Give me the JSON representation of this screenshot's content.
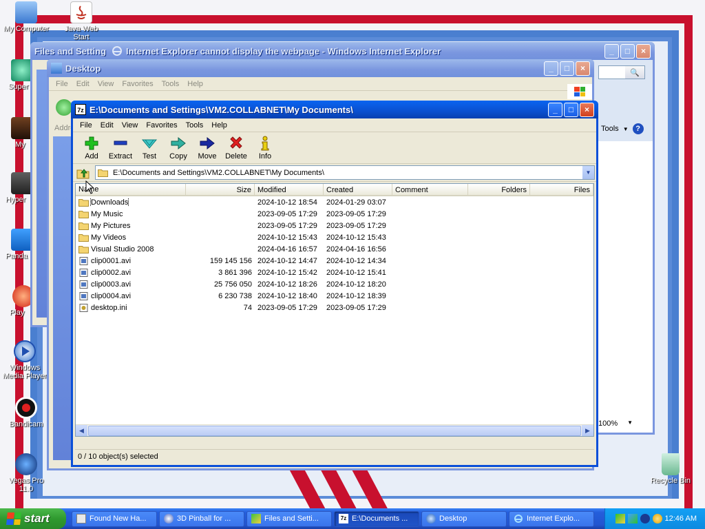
{
  "desktop": {
    "icons": [
      {
        "label": "My Computer"
      },
      {
        "label": "Java Web Start"
      },
      {
        "label": "Super"
      },
      {
        "label": "My"
      },
      {
        "label": "Hyper"
      },
      {
        "label": "Panda"
      },
      {
        "label": "Play"
      },
      {
        "label": "Windows Media Player"
      },
      {
        "label": "Bandicam"
      },
      {
        "label": "Vegas Pro 11.0"
      },
      {
        "label": "Recycle Bin"
      }
    ]
  },
  "windows": {
    "files_settings": {
      "title": "Files and Setting"
    },
    "ie": {
      "title": "Internet Explorer cannot display the webpage - Windows Internet Explorer",
      "tools_label": "Tools",
      "zoom": "100%"
    },
    "desktop_win": {
      "title": "Desktop",
      "menu": [
        "File",
        "Edit",
        "View",
        "Favorites",
        "Tools",
        "Help"
      ],
      "address_label": "Addre"
    }
  },
  "zip": {
    "title": "E:\\Documents and Settings\\VM2.COLLABNET\\My Documents\\",
    "menu": [
      "File",
      "Edit",
      "View",
      "Favorites",
      "Tools",
      "Help"
    ],
    "toolbar": {
      "add": "Add",
      "extract": "Extract",
      "test": "Test",
      "copy": "Copy",
      "move": "Move",
      "delete": "Delete",
      "info": "Info"
    },
    "address": "E:\\Documents and Settings\\VM2.COLLABNET\\My Documents\\",
    "columns": {
      "name": "Name",
      "size": "Size",
      "modified": "Modified",
      "created": "Created",
      "comment": "Comment",
      "folders": "Folders",
      "files": "Files"
    },
    "rows": [
      {
        "name": "Downloads",
        "size": "",
        "modified": "2024-10-12 18:54",
        "created": "2024-01-29 03:07",
        "type": "folder"
      },
      {
        "name": "My Music",
        "size": "",
        "modified": "2023-09-05 17:29",
        "created": "2023-09-05 17:29",
        "type": "folder"
      },
      {
        "name": "My Pictures",
        "size": "",
        "modified": "2023-09-05 17:29",
        "created": "2023-09-05 17:29",
        "type": "folder"
      },
      {
        "name": "My Videos",
        "size": "",
        "modified": "2024-10-12 15:43",
        "created": "2024-10-12 15:43",
        "type": "folder"
      },
      {
        "name": "Visual Studio 2008",
        "size": "",
        "modified": "2024-04-16 16:57",
        "created": "2024-04-16 16:56",
        "type": "folder"
      },
      {
        "name": "clip0001.avi",
        "size": "159 145 156",
        "modified": "2024-10-12 14:47",
        "created": "2024-10-12 14:34",
        "type": "file"
      },
      {
        "name": "clip0002.avi",
        "size": "3 861 396",
        "modified": "2024-10-12 15:42",
        "created": "2024-10-12 15:41",
        "type": "file"
      },
      {
        "name": "clip0003.avi",
        "size": "25 756 050",
        "modified": "2024-10-12 18:26",
        "created": "2024-10-12 18:20",
        "type": "file"
      },
      {
        "name": "clip0004.avi",
        "size": "6 230 738",
        "modified": "2024-10-12 18:40",
        "created": "2024-10-12 18:39",
        "type": "file"
      },
      {
        "name": "desktop.ini",
        "size": "74",
        "modified": "2023-09-05 17:29",
        "created": "2023-09-05 17:29",
        "type": "ini"
      }
    ],
    "status": "0 / 10 object(s) selected"
  },
  "taskbar": {
    "start": "start",
    "tasks": [
      {
        "label": "Found New Ha..."
      },
      {
        "label": "3D Pinball for ..."
      },
      {
        "label": "Files and Setti..."
      },
      {
        "label": "E:\\Documents ..."
      },
      {
        "label": "Desktop"
      },
      {
        "label": "Internet Explo..."
      }
    ],
    "clock": "12:46 AM"
  },
  "colors": {
    "xp_blue": "#0a50d0",
    "folder_yellow": "#f4d470",
    "taskbar_blue": "#245edb",
    "start_green": "#2f9a2f"
  }
}
